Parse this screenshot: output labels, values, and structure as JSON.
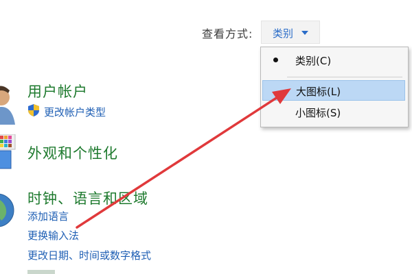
{
  "view_by": {
    "label": "查看方式:",
    "selected": "类别"
  },
  "menu": {
    "items": [
      {
        "label": "类别(C)",
        "checked": true
      },
      {
        "label": "大图标(L)",
        "highlighted": true
      },
      {
        "label": "小图标(S)"
      }
    ]
  },
  "categories": [
    {
      "title": "用户帐户",
      "icon": "user-accounts-icon",
      "links": [
        "更改帐户类型"
      ]
    },
    {
      "title": "外观和个性化",
      "icon": "appearance-icon",
      "links": []
    },
    {
      "title": "时钟、语言和区域",
      "icon": "globe-icon",
      "links": [
        "添加语言",
        "更换输入法",
        "更改日期、时间或数字格式"
      ]
    }
  ],
  "colors": {
    "category_title": "#1e7a2e",
    "link": "#1f5fb4",
    "arrow": "#e0393b",
    "menu_highlight": "#bcd8f5"
  }
}
